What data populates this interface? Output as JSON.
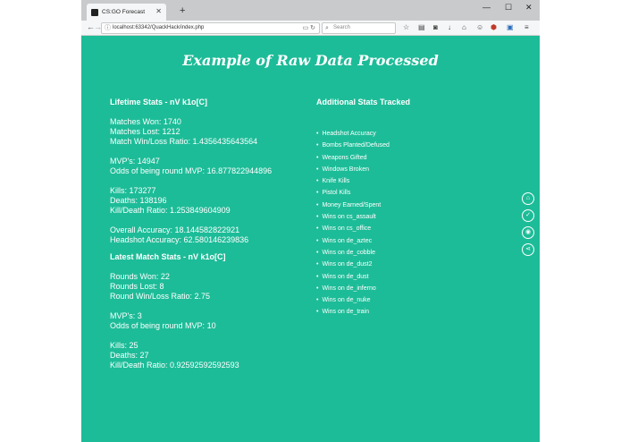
{
  "browser": {
    "tab_title": "CS:GO Forecast",
    "new_tab": "+",
    "url": "localhost:63342/QuackHack/index.php",
    "search_placeholder": "Search"
  },
  "page": {
    "title": "Example of Raw Data Processed",
    "lifetime": {
      "heading": "Lifetime Stats - nV k1o[C]",
      "lines": [
        "Matches Won: 1740",
        "Matches Lost: 1212",
        "Match Win/Loss Ratio: 1.4356435643564",
        "",
        "MVP's: 14947",
        "Odds of being round MVP: 16.877822944896",
        "",
        "Kills: 173277",
        "Deaths: 138196",
        "Kill/Death Ratio: 1.253849604909",
        "",
        "Overall Accuracy: 18.144582822921",
        "Headshot Accuracy: 62.580146239836"
      ]
    },
    "latest": {
      "heading": "Latest Match Stats - nV k1o[C]",
      "lines": [
        "Rounds Won: 22",
        "Rounds Lost: 8",
        "Round Win/Loss Ratio: 2.75",
        "",
        "MVP's: 3",
        "Odds of being round MVP: 10",
        "",
        "Kills: 25",
        "Deaths: 27",
        "Kill/Death Ratio: 0.92592592592593"
      ]
    },
    "additional": {
      "heading": "Additional Stats Tracked",
      "items": [
        "Headshot Accuracy",
        "Bombs Planted/Defused",
        "Weapons Gifted",
        "Windows Broken",
        "Knife Kills",
        "Pistol Kills",
        "Money Earned/Spent",
        "Wins on cs_assault",
        "Wins on cs_office",
        "Wins on de_aztec",
        "Wins on de_cobble",
        "Wins on de_dust2",
        "Wins on de_dust",
        "Wins on de_inferno",
        "Wins on de_nuke",
        "Wins on de_train"
      ]
    },
    "side_icons": [
      "home-icon",
      "check-icon",
      "github-icon",
      "share-icon"
    ]
  },
  "colors": {
    "background": "#1dbc98",
    "text": "#ffffff"
  }
}
